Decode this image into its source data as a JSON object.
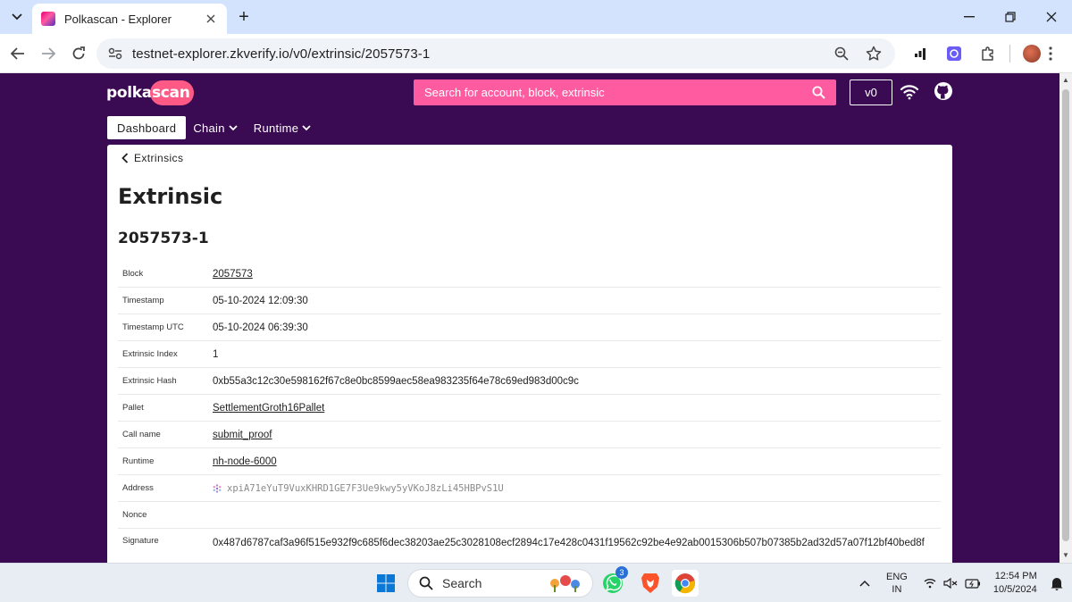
{
  "browser": {
    "tab_title": "Polkascan - Explorer",
    "url": "testnet-explorer.zkverify.io/v0/extrinsic/2057573-1"
  },
  "site": {
    "logo_text_left": "polka",
    "logo_text_right": "scan",
    "search_placeholder": "Search for account, block, extrinsic",
    "version_label": "v0",
    "nav": {
      "dashboard": "Dashboard",
      "chain": "Chain",
      "runtime": "Runtime"
    }
  },
  "content": {
    "back_label": "Extrinsics",
    "heading": "Extrinsic",
    "subheading": "2057573-1",
    "details": [
      {
        "label": "Block",
        "value": "2057573",
        "link": true
      },
      {
        "label": "Timestamp",
        "value": "05-10-2024 12:09:30",
        "link": false
      },
      {
        "label": "Timestamp UTC",
        "value": "05-10-2024 06:39:30",
        "link": false
      },
      {
        "label": "Extrinsic Index",
        "value": "1",
        "link": false
      },
      {
        "label": "Extrinsic Hash",
        "value": "0xb55a3c12c30e598162f67c8e0bc8599aec58ea983235f64e78c69ed983d00c9c",
        "link": false
      },
      {
        "label": "Pallet",
        "value": "SettlementGroth16Pallet",
        "link": true
      },
      {
        "label": "Call name",
        "value": "submit_proof",
        "link": true
      },
      {
        "label": "Runtime",
        "value": "nh-node-6000",
        "link": true
      },
      {
        "label": "Address",
        "value": "xpiA71eYuT9VuxKHRD1GE7F3Ue9kwy5yVKoJ8zLi45HBPvS1U",
        "link": false
      },
      {
        "label": "Nonce",
        "value": "",
        "link": false
      },
      {
        "label": "Signature",
        "value": "0x487d6787caf3a96f515e932f9c685f6dec38203ae25c3028108ecf2894c17e428c0431f19562c92be4e92ab0015306b507b07385b2ad32d57a07f12bf40bed8f",
        "link": false
      }
    ]
  },
  "taskbar": {
    "search_label": "Search",
    "whatsapp_badge": "3",
    "lang_line1": "ENG",
    "lang_line2": "IN",
    "time": "12:54 PM",
    "date": "10/5/2024"
  },
  "colors": {
    "page_bg": "#3a0a52",
    "search_bg": "#ff5ba1",
    "tabbar_bg": "#d3e3fd"
  }
}
